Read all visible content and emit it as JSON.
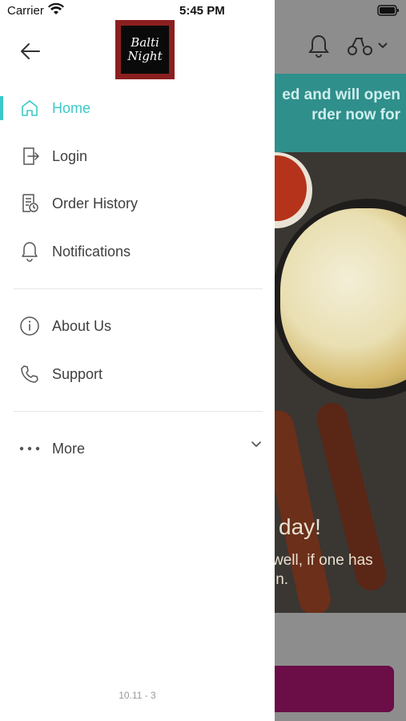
{
  "status_bar": {
    "carrier": "Carrier",
    "time": "5:45 PM"
  },
  "background": {
    "banner_text": "ed and will open\nrder now for",
    "hero_title": "day!",
    "hero_subtitle": "well, if one has\nin."
  },
  "drawer": {
    "logo_lines": [
      "Balti",
      "Night"
    ],
    "menu": [
      {
        "label": "Home",
        "icon": "home-icon",
        "active": true
      },
      {
        "label": "Login",
        "icon": "login-icon"
      },
      {
        "label": "Order History",
        "icon": "order-history-icon"
      },
      {
        "label": "Notifications",
        "icon": "bell-icon"
      },
      {
        "label": "About Us",
        "icon": "info-icon"
      },
      {
        "label": "Support",
        "icon": "phone-icon"
      },
      {
        "label": "More",
        "icon": "more-dots-icon"
      }
    ],
    "version": "10.11 - 3"
  },
  "colors": {
    "accent": "#3cc8c8",
    "banner": "#2f8f8b",
    "cta": "#6b0d47",
    "logo_red": "#8b1f1f"
  }
}
